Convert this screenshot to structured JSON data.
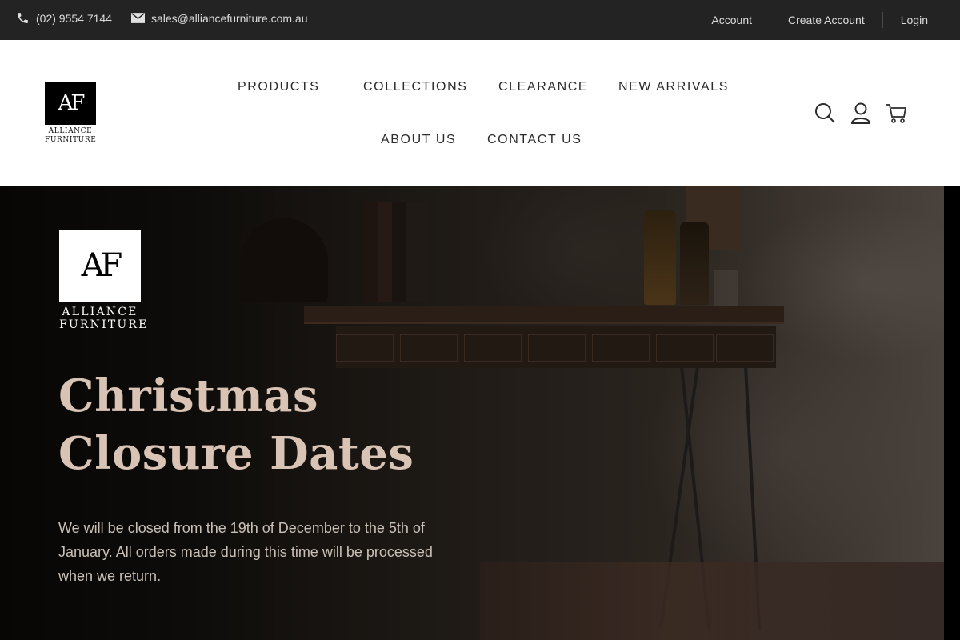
{
  "topbar": {
    "phone": "(02) 9554 7144",
    "email": "sales@alliancefurniture.com.au",
    "links": {
      "account": "Account",
      "create_account": "Create Account",
      "login": "Login"
    }
  },
  "header": {
    "logo": {
      "monogram": "AF",
      "line1": "ALLIANCE",
      "line2": "FURNITURE"
    },
    "nav": {
      "products": "PRODUCTS",
      "collections": "COLLECTIONS",
      "clearance": "CLEARANCE",
      "new_arrivals": "NEW ARRIVALS",
      "about_us": "ABOUT US",
      "contact_us": "CONTACT US"
    },
    "icons": [
      "search-icon",
      "account-icon",
      "cart-icon"
    ]
  },
  "hero": {
    "logo": {
      "monogram": "AF",
      "line1": "ALLIANCE",
      "line2": "FURNITURE"
    },
    "title_line1": "Christmas",
    "title_line2": "Closure Dates",
    "body": "We will be closed from the 19th of December to the 5th of January. All orders made during this time will be processed when we return."
  },
  "colors": {
    "topbar_bg": "#232323",
    "header_bg": "#ffffff",
    "hero_title": "#d9c3b4",
    "hero_text": "#c9c0b8"
  }
}
